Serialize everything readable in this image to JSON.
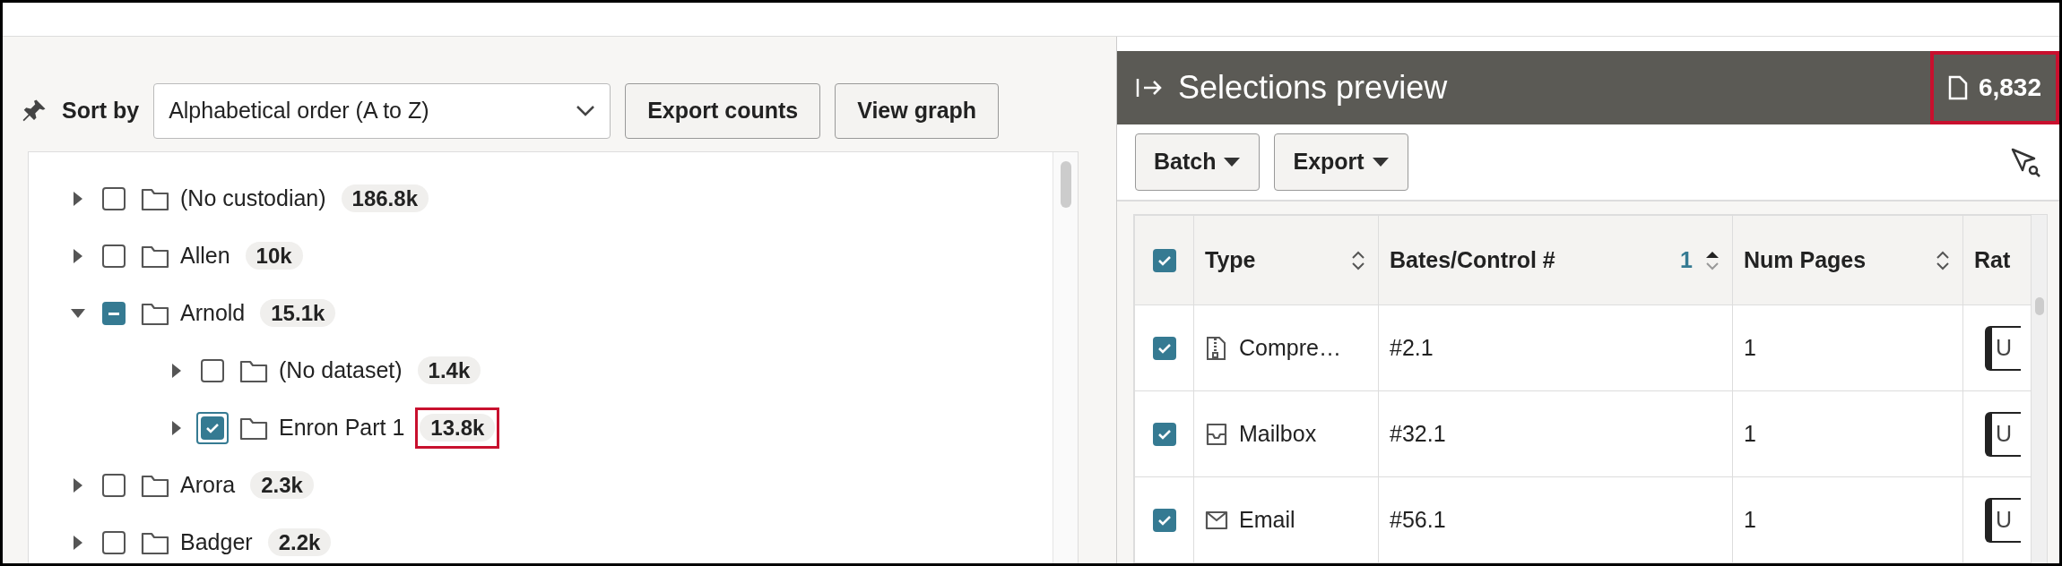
{
  "sort": {
    "label": "Sort by",
    "value": "Alphabetical order (A to Z)"
  },
  "toolbar_buttons": [
    "Export counts",
    "View graph"
  ],
  "tree": [
    {
      "label": "(No custodian)",
      "count": "186.8k",
      "expanded": false,
      "checked": false,
      "partial": false,
      "focused": false,
      "highlighted": false
    },
    {
      "label": "Allen",
      "count": "10k",
      "expanded": false,
      "checked": false,
      "partial": false,
      "focused": false,
      "highlighted": false
    },
    {
      "label": "Arnold",
      "count": "15.1k",
      "expanded": true,
      "checked": false,
      "partial": true,
      "focused": false,
      "highlighted": false,
      "children": [
        {
          "label": "(No dataset)",
          "count": "1.4k",
          "expanded": false,
          "checked": false,
          "partial": false,
          "focused": false,
          "highlighted": false
        },
        {
          "label": "Enron Part 1",
          "count": "13.8k",
          "expanded": false,
          "checked": true,
          "partial": false,
          "focused": true,
          "highlighted": true
        }
      ]
    },
    {
      "label": "Arora",
      "count": "2.3k",
      "expanded": false,
      "checked": false,
      "partial": false,
      "focused": false,
      "highlighted": false
    },
    {
      "label": "Badger",
      "count": "2.2k",
      "expanded": false,
      "checked": false,
      "partial": false,
      "focused": false,
      "highlighted": false
    }
  ],
  "preview": {
    "title": "Selections preview",
    "count": "6,832",
    "count_highlighted": true,
    "buttons": [
      "Batch",
      "Export"
    ],
    "table": {
      "all_checked": true,
      "columns": [
        {
          "label": "Type",
          "sorted": false
        },
        {
          "label": "Bates/Control #",
          "sorted": true,
          "sort_index": "1"
        },
        {
          "label": "Num Pages",
          "sorted": false
        },
        {
          "label": "Rat"
        }
      ],
      "rows": [
        {
          "checked": true,
          "kind": "compressed",
          "type": "Compre…",
          "bates": "#2.1",
          "pages": "1",
          "column_4": "U"
        },
        {
          "checked": true,
          "kind": "mailbox",
          "type": "Mailbox",
          "bates": "#32.1",
          "pages": "1",
          "column_4": "U"
        },
        {
          "checked": true,
          "kind": "email",
          "type": "Email",
          "bates": "#56.1",
          "pages": "1",
          "column_4": "U"
        }
      ]
    }
  }
}
